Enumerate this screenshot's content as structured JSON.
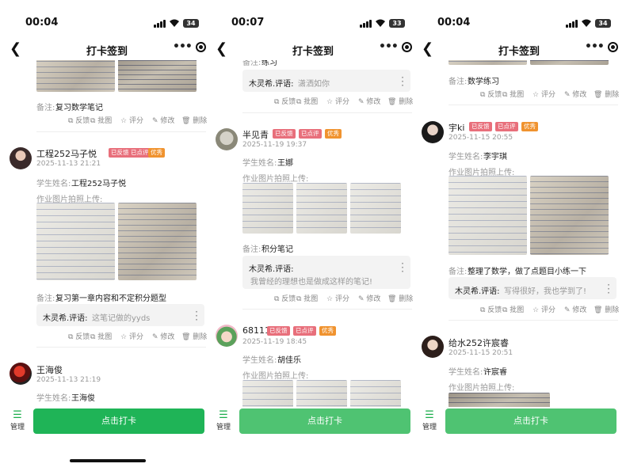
{
  "common": {
    "page_title": "打卡签到",
    "manage_label": "管理",
    "checkin_button": "点击打卡",
    "tag_feedback": "已反馈",
    "tag_reviewed": "已点评",
    "tag_excellent": "优秀",
    "student_label": "学生姓名:",
    "photo_label": "作业图片拍照上传:",
    "remark_label": "备注:",
    "actions": {
      "feedback": "反馈",
      "review": "批图",
      "rate": "评分",
      "edit": "修改",
      "delete": "删除"
    }
  },
  "screens": [
    {
      "time": "00:04",
      "battery": "34",
      "top_remark": "复习数学笔记",
      "posts": [
        {
          "user": "工程252马子悦",
          "date": "2025-11-13 21:21",
          "student": "工程252马子悦",
          "remark": "复习第一章内容和不定积分题型",
          "comment_author": "木灵希.评语:",
          "comment_text": "这笔记做的yyds"
        },
        {
          "user": "王海俊",
          "date": "2025-11-13 21:19",
          "student": "王海俊"
        }
      ]
    },
    {
      "time": "00:07",
      "battery": "33",
      "top_remark": "练习",
      "top_comment_author": "木灵希.评语:",
      "top_comment_text": "潇洒如你",
      "posts": [
        {
          "user": "半见青",
          "date": "2025-11-19 19:37",
          "student": "王娜",
          "remark": "积分笔记",
          "comment_author": "木灵希.评语:",
          "comment_text": "我曾经的理想也是做成这样的笔记!"
        },
        {
          "user": "68111",
          "date": "2025-11-19 18:45",
          "student": "胡佳乐"
        }
      ]
    },
    {
      "time": "00:04",
      "battery": "34",
      "top_remark": "数学练习",
      "posts": [
        {
          "user": "宇ki",
          "date": "2025-11-15 20:55",
          "student": "李宇琪",
          "remark": "整理了数学，做了点题目小练一下",
          "comment_author": "木灵希.评语:",
          "comment_text": "写得很好，我也学到了!"
        },
        {
          "user": "给水252许宸睿",
          "date": "2025-11-15 20:51",
          "student": "许宸睿"
        }
      ]
    }
  ]
}
